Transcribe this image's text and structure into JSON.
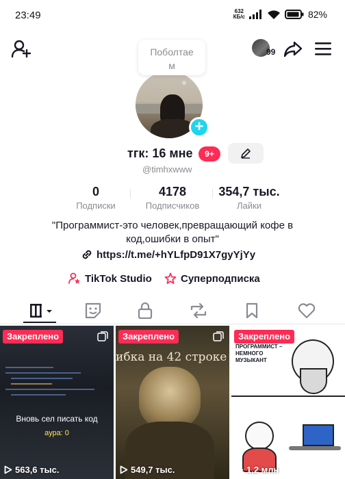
{
  "status_bar": {
    "time": "23:49",
    "net_speed_value": "632",
    "net_speed_unit": "КБ/с",
    "battery": "82%"
  },
  "header": {
    "bubble_text": "Поболтае\nм",
    "viewers_count": "99"
  },
  "profile": {
    "name": "тгк: 16 мне",
    "notification_badge": "9+",
    "handle": "@timhxwww",
    "stats": [
      {
        "value": "0",
        "label": "Подписки"
      },
      {
        "value": "4178",
        "label": "Подписчиков"
      },
      {
        "value": "354,7 тыс.",
        "label": "Лайки"
      }
    ],
    "bio": "\"Программист-это человек,превращающий кофе в код,ошибки в опыт\"",
    "link": "https://t.me/+hYLfpD91X7gyYjYy",
    "studio_label": "TikTok Studio",
    "subscription_label": "Суперподписка"
  },
  "tabs": [
    "videos",
    "reposts-stickers",
    "private",
    "reposts",
    "favorites",
    "liked"
  ],
  "videos": [
    {
      "pinned_label": "Закреплено",
      "views": "563,6 тыс.",
      "caption": "Вновь сел писать код",
      "subcaption": "аура: 0"
    },
    {
      "pinned_label": "Закреплено",
      "views": "549,7 тыс.",
      "caption": "ибка на 42 строке"
    },
    {
      "pinned_label": "Закреплено",
      "views": "1,2 млн",
      "caption": "ПРОГРАММИСТ –\nНЕМНОГО\nМУЗЫКАНТ"
    }
  ],
  "colors": {
    "accent_red": "#fe2c55",
    "accent_cyan": "#20d5ec",
    "text_primary": "#161823",
    "text_secondary": "#8a8b91"
  }
}
